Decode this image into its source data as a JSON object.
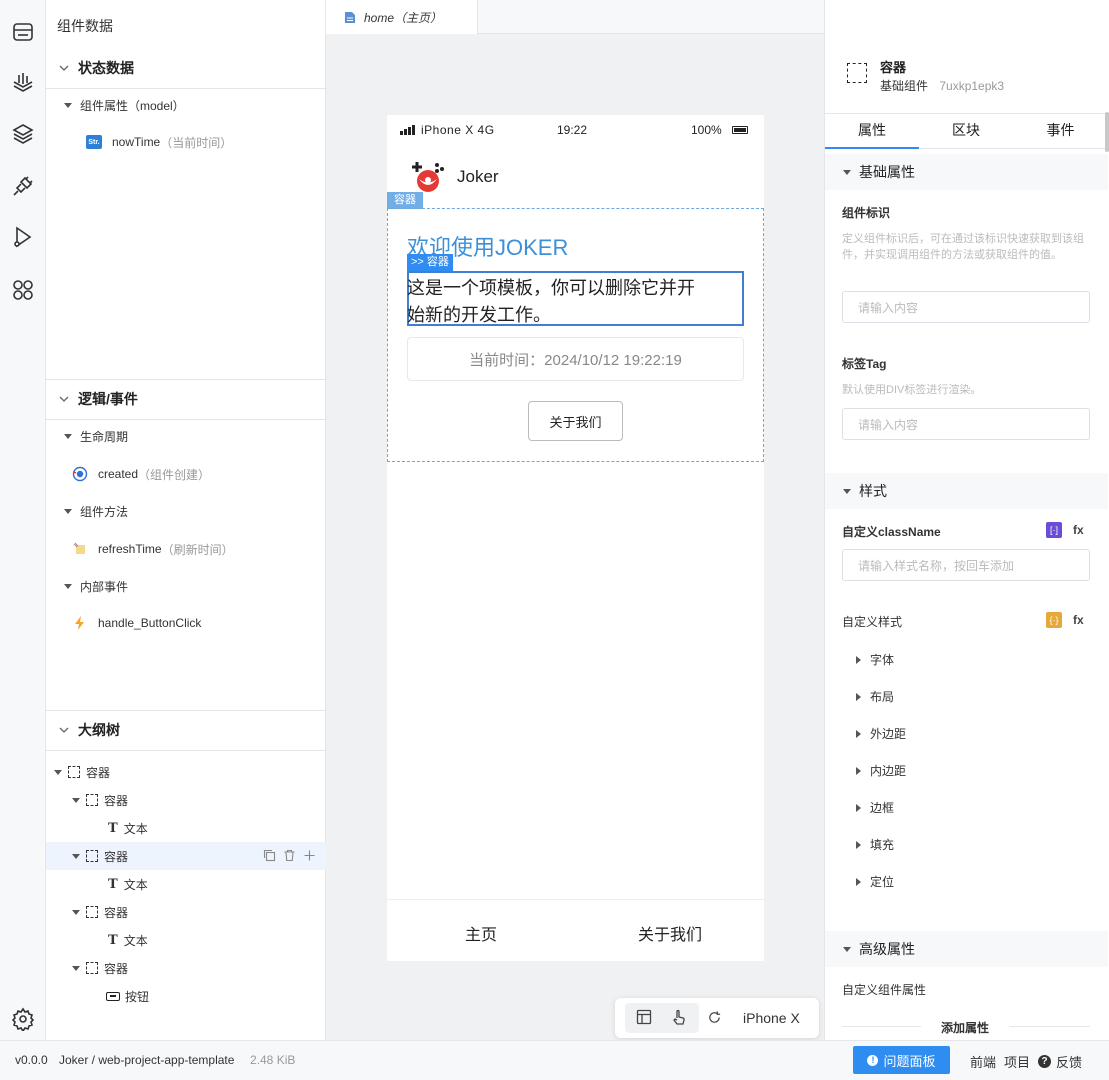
{
  "left_panel": {
    "title": "组件数据",
    "state_section": {
      "title": "状态数据",
      "group_label": "组件属性（model）",
      "item_badge": "Str.",
      "item_name": "nowTime",
      "item_hint": "（当前时间）"
    },
    "logic_section": {
      "title": "逻辑/事件",
      "lifecycle_label": "生命周期",
      "created_name": "created",
      "created_hint": "（组件创建）",
      "methods_label": "组件方法",
      "method_name": "refreshTime",
      "method_hint": "（刷新时间）",
      "events_label": "内部事件",
      "event_name": "handle_ButtonClick"
    },
    "outline_section": {
      "title": "大纲树",
      "nodes": [
        {
          "label": "容器"
        },
        {
          "label": "容器"
        },
        {
          "label": "文本"
        },
        {
          "label": "容器"
        },
        {
          "label": "文本"
        },
        {
          "label": "容器"
        },
        {
          "label": "文本"
        },
        {
          "label": "容器"
        },
        {
          "label": "按钮"
        }
      ]
    }
  },
  "editor": {
    "tab_label": "home（主页）",
    "device_label": "iPhone X"
  },
  "phone": {
    "carrier": "iPhone X 4G",
    "time": "19:22",
    "battery": "100%",
    "app_name": "Joker",
    "container_tag": "容器",
    "inner_tag": ">> 容器",
    "heading": "欢迎使用JOKER",
    "desc_line1": "这是一个项模板，你可以删除它并开",
    "desc_line2": "始新的开发工作。",
    "time_text": "当前时间：2024/10/12 19:22:19",
    "button_label": "关于我们",
    "nav_home": "主页",
    "nav_about": "关于我们"
  },
  "right_panel": {
    "component_name": "容器",
    "component_type": "基础组件",
    "component_id": "7uxkp1epk3",
    "tabs": [
      "属性",
      "区块",
      "事件"
    ],
    "basic_section": "基础属性",
    "id_label": "组件标识",
    "id_desc": "定义组件标识后，可在通过该标识快速获取到该组件，并实现调用组件的方法或获取组件的值。",
    "id_placeholder": "请输入内容",
    "tag_label": "标签Tag",
    "tag_desc": "默认使用DIV标签进行渲染。",
    "tag_placeholder": "请输入内容",
    "style_section": "样式",
    "classname_label": "自定义className",
    "classname_placeholder": "请输入样式名称，按回车添加",
    "fx": "fx",
    "style_label": "自定义样式",
    "style_items": [
      "字体",
      "布局",
      "外边距",
      "内边距",
      "边框",
      "填充",
      "定位"
    ],
    "advanced_section": "高级属性",
    "custom_attr_label": "自定义组件属性",
    "add_attr": "添加属性"
  },
  "status_bar": {
    "version": "v0.0.0",
    "project": "Joker / web-project-app-template",
    "size": "2.48 KiB",
    "problems": "问题面板",
    "frontend": "前端",
    "project_link": "项目",
    "feedback": "反馈"
  },
  "colors": {
    "accent": "#2f8cf0",
    "select_dash": "#6aa8e0",
    "tag_bg": "#72aee6",
    "heading": "#3d8fd8"
  }
}
